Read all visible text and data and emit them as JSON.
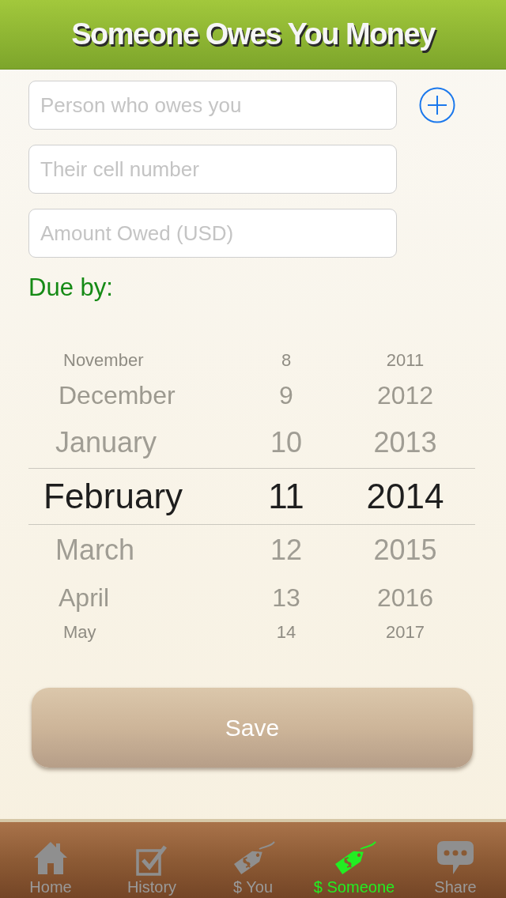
{
  "header": {
    "title": "Someone Owes You Money"
  },
  "form": {
    "fields": [
      {
        "placeholder": "Person who owes you"
      },
      {
        "placeholder": "Their cell number"
      },
      {
        "placeholder": "Amount Owed (USD)"
      }
    ],
    "due_label": "Due by:"
  },
  "date_picker": {
    "rows": [
      {
        "month": "November",
        "day": "8",
        "year": "2011",
        "selected": false
      },
      {
        "month": "December",
        "day": "9",
        "year": "2012",
        "selected": false
      },
      {
        "month": "January",
        "day": "10",
        "year": "2013",
        "selected": false
      },
      {
        "month": "February",
        "day": "11",
        "year": "2014",
        "selected": true
      },
      {
        "month": "March",
        "day": "12",
        "year": "2015",
        "selected": false
      },
      {
        "month": "April",
        "day": "13",
        "year": "2016",
        "selected": false
      },
      {
        "month": "May",
        "day": "14",
        "year": "2017",
        "selected": false
      }
    ]
  },
  "save_button": {
    "label": "Save"
  },
  "tab_bar": {
    "tabs": [
      {
        "label": "Home",
        "selected": false
      },
      {
        "label": "History",
        "selected": false
      },
      {
        "label": "$ You",
        "selected": false
      },
      {
        "label": "$ Someone",
        "selected": true
      },
      {
        "label": "Share",
        "selected": false
      }
    ]
  }
}
